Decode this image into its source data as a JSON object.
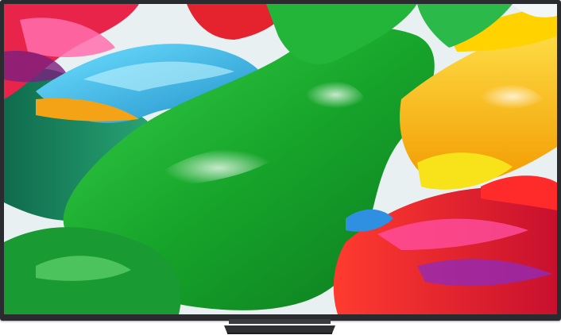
{
  "product": {
    "type": "television",
    "screen_art": "abstract-colorful-paint-swirls",
    "colors": {
      "bezel": "#2a2b2e",
      "stand": "#3a3b3e",
      "red": "#e5232f",
      "magenta": "#e63a8c",
      "cyan": "#2fb7e8",
      "green": "#1fb236",
      "yellow": "#f5c400",
      "orange": "#f28a16"
    }
  }
}
